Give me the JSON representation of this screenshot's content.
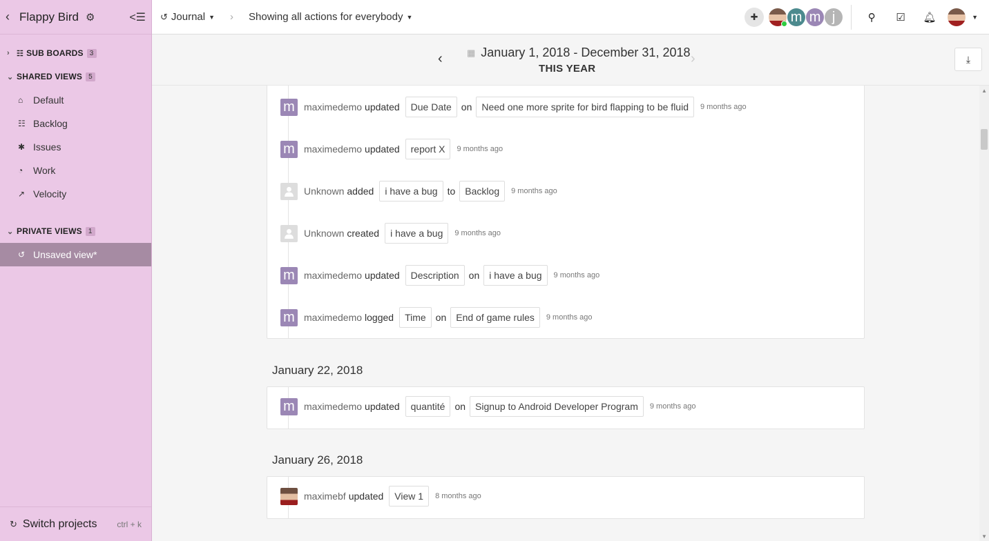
{
  "sidebar": {
    "project_title": "Flappy Bird",
    "sections": {
      "sub_boards": {
        "label": "SUB BOARDS",
        "count": "3"
      },
      "shared_views": {
        "label": "SHARED VIEWS",
        "count": "5"
      },
      "private_views": {
        "label": "PRIVATE VIEWS",
        "count": "1"
      }
    },
    "shared_items": [
      "Default",
      "Backlog",
      "Issues",
      "Work",
      "Velocity"
    ],
    "private_items": [
      "Unsaved view*"
    ],
    "footer": {
      "label": "Switch projects",
      "shortcut": "ctrl + k"
    }
  },
  "topbar": {
    "view_label": "Journal",
    "filter_label": "Showing all actions for everybody",
    "member_avatars": [
      "m",
      "m",
      "j"
    ]
  },
  "datebar": {
    "range": "January 1, 2018 - December 31, 2018",
    "subtitle": "THIS YEAR"
  },
  "journal": {
    "group1": [
      {
        "user": "maximedemo",
        "verb": "updated",
        "tag1": "Due Date",
        "conn": "on",
        "tag2": "Need one more sprite for bird flapping to be fluid",
        "ago": "9 months ago"
      },
      {
        "user": "maximedemo",
        "verb": "updated",
        "tag1": "report X",
        "conn": "",
        "tag2": "",
        "ago": "9 months ago"
      },
      {
        "user": "Unknown",
        "verb": "added",
        "tag1": "i have a bug",
        "conn": "to",
        "tag2": "Backlog",
        "ago": "9 months ago"
      },
      {
        "user": "Unknown",
        "verb": "created",
        "tag1": "i have a bug",
        "conn": "",
        "tag2": "",
        "ago": "9 months ago"
      },
      {
        "user": "maximedemo",
        "verb": "updated",
        "tag1": "Description",
        "conn": "on",
        "tag2": "i have a bug",
        "ago": "9 months ago"
      },
      {
        "user": "maximedemo",
        "verb": "logged",
        "tag1": "Time",
        "conn": "on",
        "tag2": "End of game rules",
        "ago": "9 months ago"
      }
    ],
    "day2": {
      "heading": "January 22, 2018",
      "entries": [
        {
          "user": "maximedemo",
          "verb": "updated",
          "tag1": "quantité",
          "conn": "on",
          "tag2": "Signup to Android Developer Program",
          "ago": "9 months ago"
        }
      ]
    },
    "day3": {
      "heading": "January 26, 2018",
      "entries": [
        {
          "user": "maximebf",
          "verb": "updated",
          "tag1": "View 1",
          "conn": "",
          "tag2": "",
          "ago": "8 months ago"
        }
      ]
    },
    "avatar_letter": "m"
  },
  "colors": {
    "sidebar_bg": "#ebc8e6",
    "sidebar_active": "#a68ba3",
    "avatar_purple": "#9b87b5",
    "avatar_teal": "#4c8a8e",
    "avatar_gray": "#b5b5b5"
  }
}
